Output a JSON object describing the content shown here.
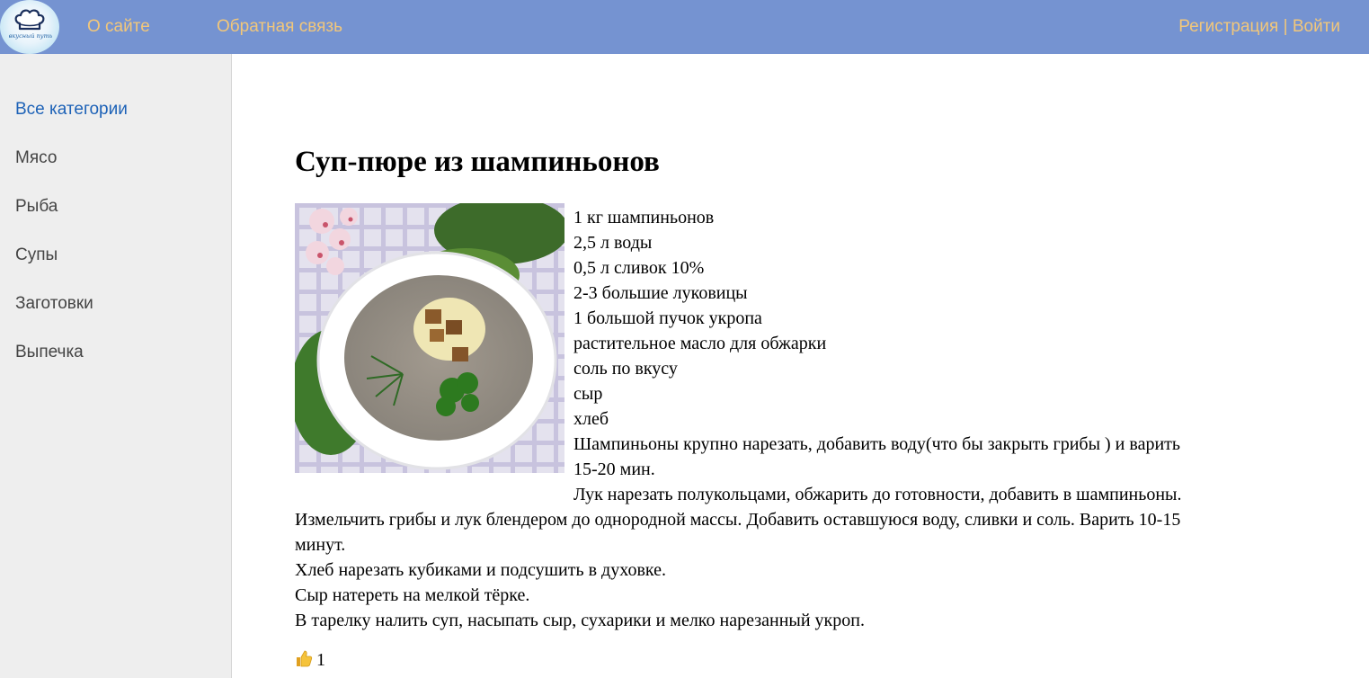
{
  "header": {
    "logo_text": "вкусный путь",
    "nav": {
      "about": "О сайте",
      "feedback": "Обратная связь",
      "register": "Регистрация",
      "separator": "|",
      "login": "Войти"
    },
    "bg_color": "#7593d1",
    "link_color": "#f2c77a"
  },
  "sidebar": {
    "items": [
      {
        "label": "Все категории",
        "active": true
      },
      {
        "label": "Мясо",
        "active": false
      },
      {
        "label": "Рыба",
        "active": false
      },
      {
        "label": "Супы",
        "active": false
      },
      {
        "label": "Заготовки",
        "active": false
      },
      {
        "label": "Выпечка",
        "active": false
      }
    ],
    "active_color": "#1d62b7"
  },
  "recipe": {
    "title": "Суп-пюре из шампиньонов",
    "image_alt": "bowl-of-mushroom-soup",
    "ingredients": [
      "1 кг шампиньонов",
      "2,5 л воды",
      "0,5 л сливок 10%",
      "2-3 большие луковицы",
      "1 большой пучок укропа",
      "растительное масло для обжарки",
      "соль по вкусу",
      "сыр",
      "хлеб"
    ],
    "steps": [
      "Шампиньоны крупно нарезать, добавить воду(что бы закрыть грибы ) и варить",
      "15-20 мин.",
      "Лук нарезать полукольцами, обжарить до готовности, добавить в шампиньоны.",
      "Измельчить грибы и лук блендером до однородной массы. Добавить оставшуюся воду, сливки и соль. Варить 10-15",
      "минут.",
      "Хлеб нарезать кубиками и подсушить в духовке.",
      "Сыр натереть на мелкой тёрке.",
      "В тарелку налить суп, насыпать сыр, сухарики и мелко нарезанный укроп."
    ],
    "likes": {
      "icon": "thumbs-up-icon",
      "count": "1"
    }
  }
}
